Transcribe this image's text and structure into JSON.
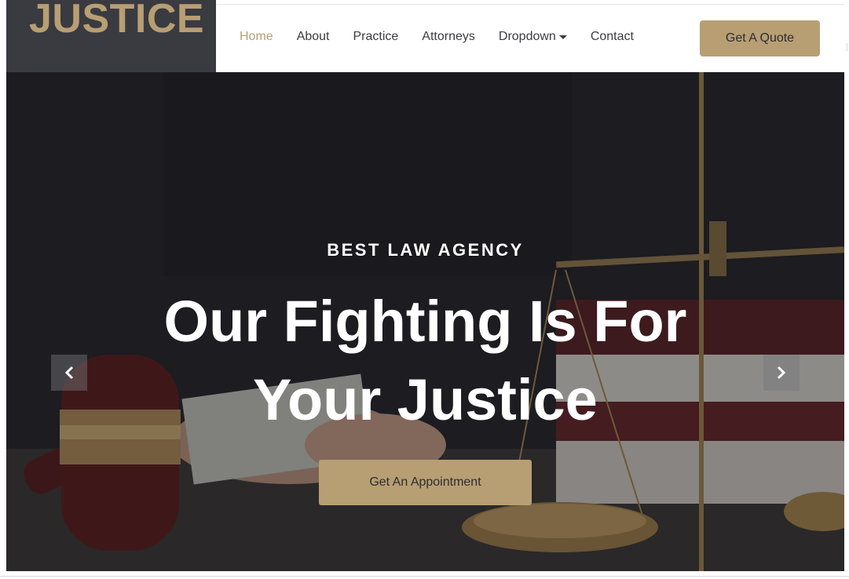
{
  "brand": {
    "logo_text": "JUSTICE"
  },
  "nav": {
    "items": [
      {
        "label": "Home",
        "active": true
      },
      {
        "label": "About",
        "active": false
      },
      {
        "label": "Practice",
        "active": false
      },
      {
        "label": "Attorneys",
        "active": false
      },
      {
        "label": "Dropdown",
        "active": false,
        "has_caret": true
      },
      {
        "label": "Contact",
        "active": false
      }
    ],
    "cta_label": "Get A Quote"
  },
  "hero": {
    "tagline": "BEST LAW AGENCY",
    "title_line1": "Our Fighting Is For",
    "title_line2": "Your Justice",
    "cta_label": "Get An Appointment",
    "prev_icon": "chevron-left-icon",
    "next_icon": "chevron-right-icon"
  },
  "colors": {
    "accent": "#b79f73",
    "dark": "#3a3a41",
    "nav_text": "#3b3b44",
    "white": "#ffffff"
  }
}
